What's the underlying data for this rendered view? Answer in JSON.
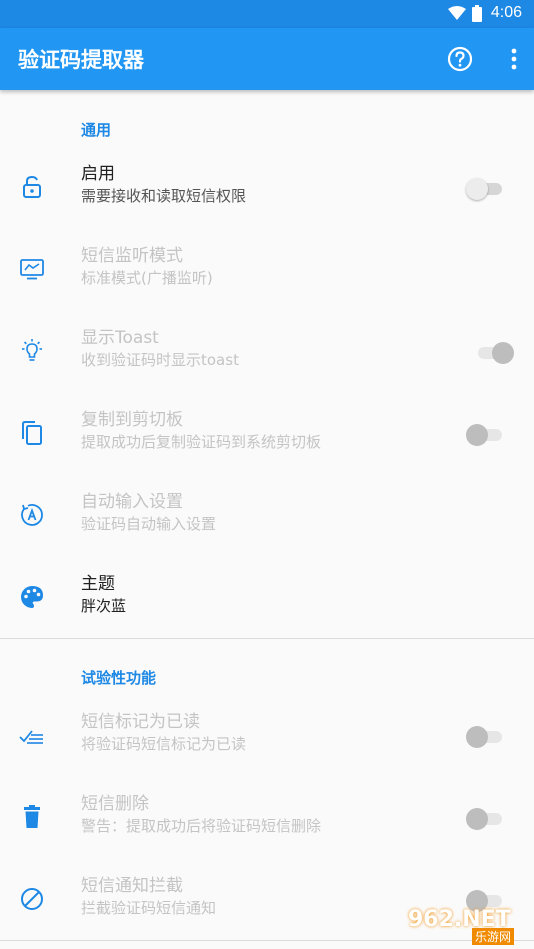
{
  "status_bar": {
    "time": "4:06"
  },
  "app_bar": {
    "title": "验证码提取器",
    "help_icon": "help-circle-icon",
    "more_icon": "more-vert-icon"
  },
  "colors": {
    "primary": "#2196f3",
    "accent": "#1e88e5"
  },
  "sections": {
    "general": {
      "header": "通用"
    },
    "experimental": {
      "header": "试验性功能"
    }
  },
  "rows": {
    "enable": {
      "title": "启用",
      "summary": "需要接收和读取短信权限",
      "icon": "lock-open-icon",
      "toggle_on": false,
      "enabled": true
    },
    "listen_mode": {
      "title": "短信监听模式",
      "summary": "标准模式(广播监听)",
      "icon": "monitor-icon",
      "enabled": false
    },
    "show_toast": {
      "title": "显示Toast",
      "summary": "收到验证码时显示toast",
      "icon": "lightbulb-icon",
      "toggle_on": true,
      "enabled": false
    },
    "copy_clipboard": {
      "title": "复制到剪切板",
      "summary": "提取成功后复制验证码到系统剪切板",
      "icon": "copy-icon",
      "toggle_on": false,
      "enabled": false
    },
    "auto_input": {
      "title": "自动输入设置",
      "summary": "验证码自动输入设置",
      "icon": "auto-input-icon",
      "enabled": false
    },
    "theme": {
      "title": "主题",
      "summary": "胖次蓝",
      "icon": "palette-icon",
      "enabled": true
    },
    "mark_read": {
      "title": "短信标记为已读",
      "summary": "将验证码短信标记为已读",
      "icon": "mark-read-icon",
      "toggle_on": false,
      "enabled": false
    },
    "delete_sms": {
      "title": "短信删除",
      "summary": "警告：提取成功后将验证码短信删除",
      "icon": "delete-icon",
      "toggle_on": false,
      "enabled": false
    },
    "block_notification": {
      "title": "短信通知拦截",
      "summary": "拦截验证码短信通知",
      "icon": "block-icon",
      "toggle_on": false,
      "enabled": false
    }
  },
  "watermark": {
    "main": "962.NET",
    "sub": "乐游网"
  }
}
